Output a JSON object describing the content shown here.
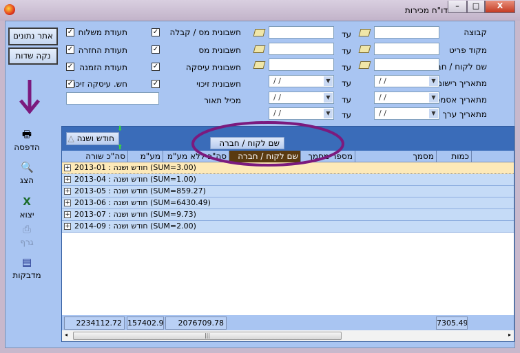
{
  "window": {
    "title": "דו\"ח מכירות",
    "minimize": "–",
    "maximize": "□",
    "close": "X"
  },
  "filters": {
    "labels": [
      "קבוצה",
      "מקוד פריט",
      "שם לקוח / חברה",
      "מתאריך רישום",
      "מתאריך אסמכתא",
      "מתאריך ערך"
    ],
    "to_label": "עד",
    "date_placeholder": "/ /"
  },
  "doc_types": [
    {
      "label": "חשבונית מס / קבלה",
      "checked": true
    },
    {
      "label": "חשבונית מס",
      "checked": true
    },
    {
      "label": "חשבונית עיסקה",
      "checked": true
    },
    {
      "label": "חשבונית זיכוי",
      "checked": true
    }
  ],
  "doc_types2": [
    {
      "label": "תעודת משלוח",
      "checked": true
    },
    {
      "label": "תעודת החזרה",
      "checked": true
    },
    {
      "label": "תעודת הזמנה",
      "checked": true
    },
    {
      "label": "חש. עיסקה זיכוי",
      "checked": true
    }
  ],
  "contains_desc_label": "מכיל תאור",
  "buttons": {
    "find": "אתר נתונים",
    "clear": "נקה שדות"
  },
  "toolbar": [
    {
      "label": "הדפסה",
      "icon": "printer-icon"
    },
    {
      "label": "הצג",
      "icon": "preview-icon"
    },
    {
      "label": "יצוא",
      "icon": "excel-icon"
    },
    {
      "label": "גרף",
      "icon": "chart-icon",
      "disabled": true
    },
    {
      "label": "מדבקות",
      "icon": "labels-icon"
    }
  ],
  "grid": {
    "group_by": "חודש ושנה",
    "dragging_column": "שם לקוח / חברה",
    "columns": [
      "כמות",
      "מסמך",
      "מספר מסמך",
      "שם לקוח / חברה",
      "סה\"כ ללא מע\"מ",
      "מע\"מ",
      "סה\"כ שורה"
    ],
    "rows": [
      "2013-01 : חודש ושנה (SUM=3.00)",
      "2013-04 : חודש ושנה (SUM=1.00)",
      "2013-05 : חודש ושנה (SUM=859.27)",
      "2013-06 : חודש ושנה (SUM=6430.49)",
      "2013-07 : חודש ושנה (SUM=9.73)",
      "2014-09 : חודש ושנה (SUM=2.00)"
    ],
    "totals": {
      "line_total": "2234112.72",
      "vat": "157402.9",
      "total_excl_vat": "2076709.78",
      "quantity": "7305.49"
    }
  },
  "colors": {
    "accent": "#3a6cb9",
    "annotation": "#7b1a7e",
    "selected_row": "#fde9b8"
  }
}
